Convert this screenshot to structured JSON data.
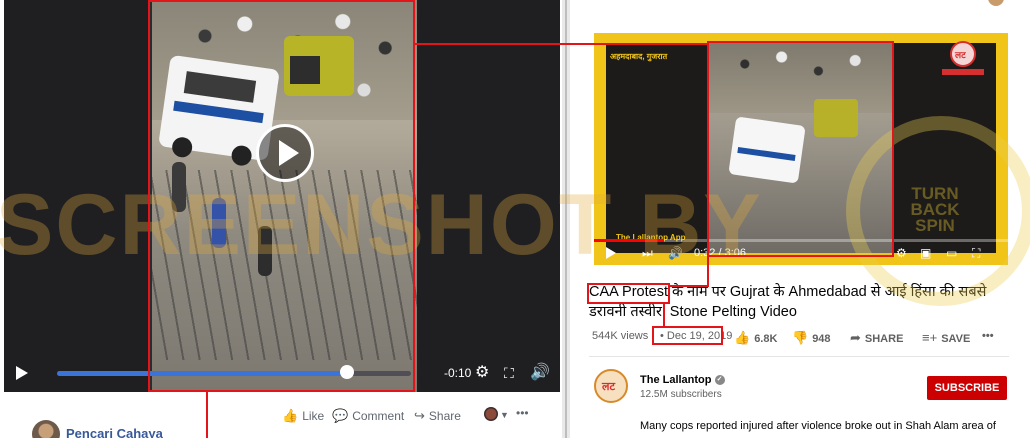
{
  "watermark": "SCREENSHOT BY",
  "stamp": {
    "line1": "TURN",
    "line2": "BACK",
    "line3": "SPIN"
  },
  "facebook": {
    "video": {
      "time_remaining": "-0:10",
      "progress": 0.82,
      "settings_icon": "gear-icon",
      "fullscreen_icon": "expand-icon",
      "volume_icon": "speaker-icon"
    },
    "actions": [
      {
        "label": "Like",
        "icon": "thumbs-up-icon"
      },
      {
        "label": "Comment",
        "icon": "comment-icon"
      },
      {
        "label": "Share",
        "icon": "share-icon"
      }
    ],
    "more": "•••",
    "author": "Pencari Cahaya"
  },
  "youtube": {
    "video": {
      "location_caption": "अहमदाबाद, गुजरात",
      "brand_small": "The Lallantop App",
      "time": "0:32 / 3:06",
      "progress": 0.17
    },
    "title": "CAA Protest के नाम पर Gujrat के Ahmedabad से आई हिंसा की सबसे डरावनी तस्वीर| Stone Pelting Video",
    "views": "544K views",
    "date": "Dec 19, 2019",
    "likes": "6.8K",
    "dislikes": "948",
    "share_label": "SHARE",
    "save_label": "SAVE",
    "more": "•••",
    "channel": {
      "name": "The Lallantop",
      "subscribers": "12.5M subscribers",
      "subscribe_label": "SUBSCRIBE"
    },
    "description": "Many cops reported injured after violence broke out in Shah Alam area of"
  }
}
